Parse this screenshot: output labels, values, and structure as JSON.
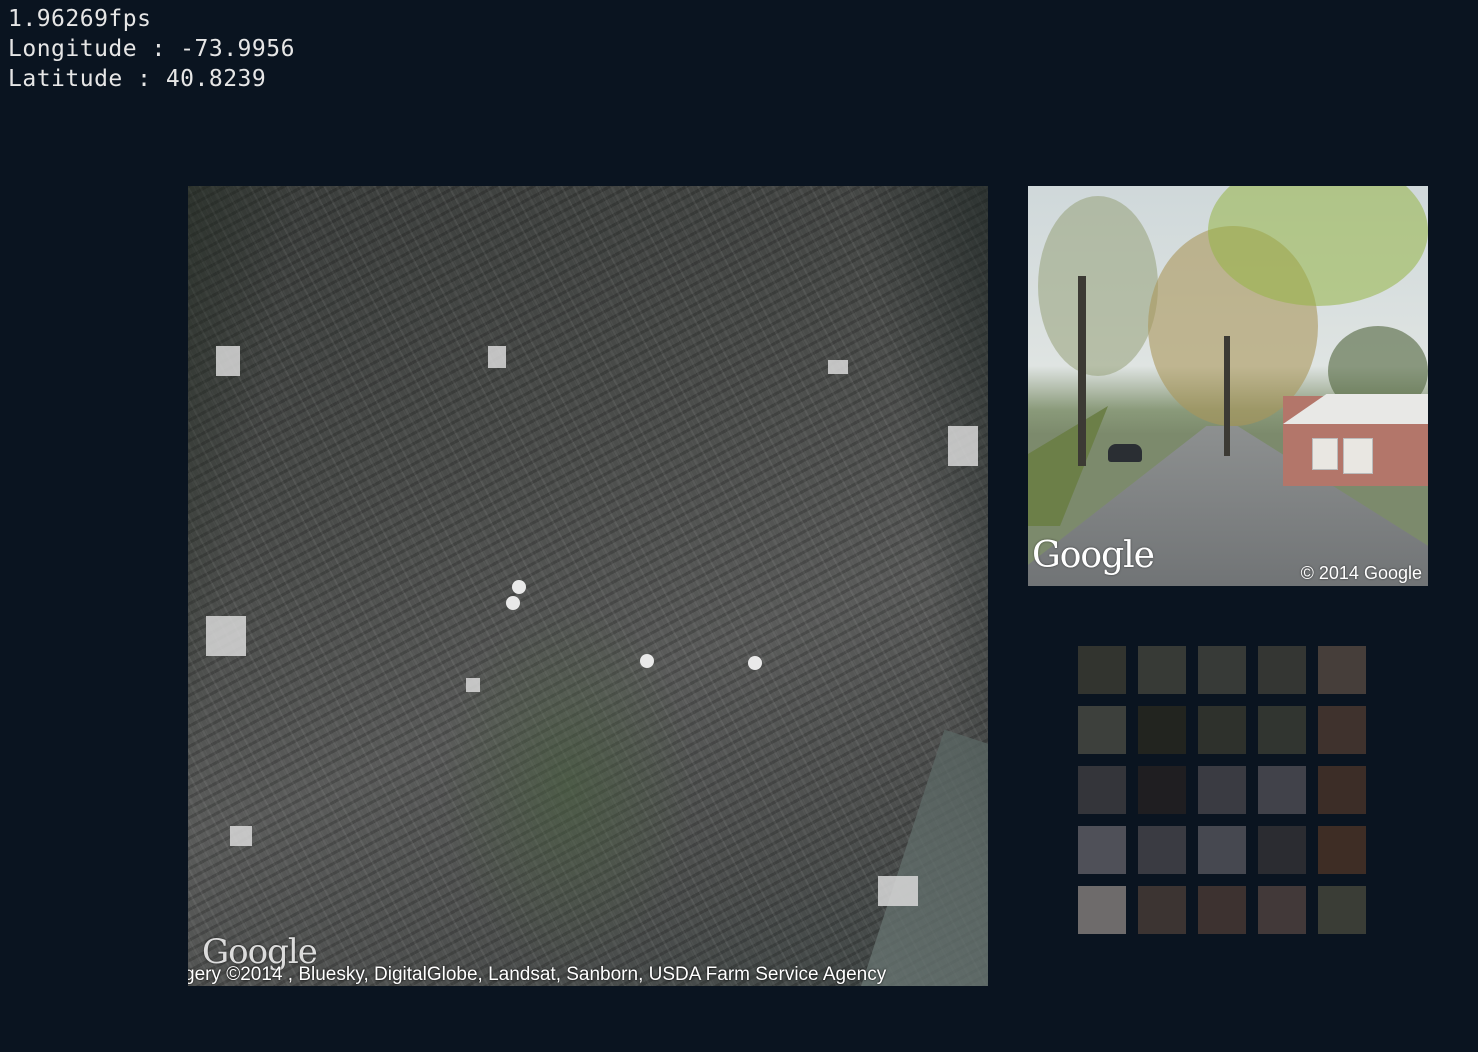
{
  "hud": {
    "fps": "1.96269fps",
    "longitude": "Longitude : -73.9956",
    "latitude": "Latitude : 40.8239"
  },
  "satellite": {
    "logo": "Google",
    "attribution": "gery ©2014 , Bluesky, DigitalGlobe, Landsat, Sanborn, USDA Farm Service Agency"
  },
  "street_view": {
    "logo": "Google",
    "copyright": "© 2014 Google"
  },
  "palette": {
    "rows": [
      [
        "#32342f",
        "#373a36",
        "#373a37",
        "#343633",
        "#463e3a"
      ],
      [
        "#3d403c",
        "#22241f",
        "#2e312c",
        "#313530",
        "#3f322d"
      ],
      [
        "#34353a",
        "#1f1e21",
        "#3a3b42",
        "#41424a",
        "#3c2d27"
      ],
      [
        "#4f5058",
        "#3a3b42",
        "#464850",
        "#2b2c31",
        "#3e2d25"
      ],
      [
        "#6e6b6b",
        "#3c3432",
        "#3d3230",
        "#423939",
        "#3a3d36"
      ]
    ]
  }
}
